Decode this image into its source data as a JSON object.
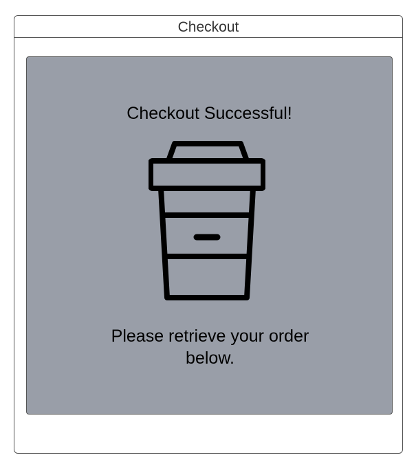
{
  "window": {
    "title": "Checkout"
  },
  "panel": {
    "heading": "Checkout Successful!",
    "icon": "coffee-cup-icon",
    "message": "Please retrieve your order below."
  },
  "colors": {
    "panel_background": "#999ea8",
    "border": "#555555",
    "icon": "#000000"
  }
}
